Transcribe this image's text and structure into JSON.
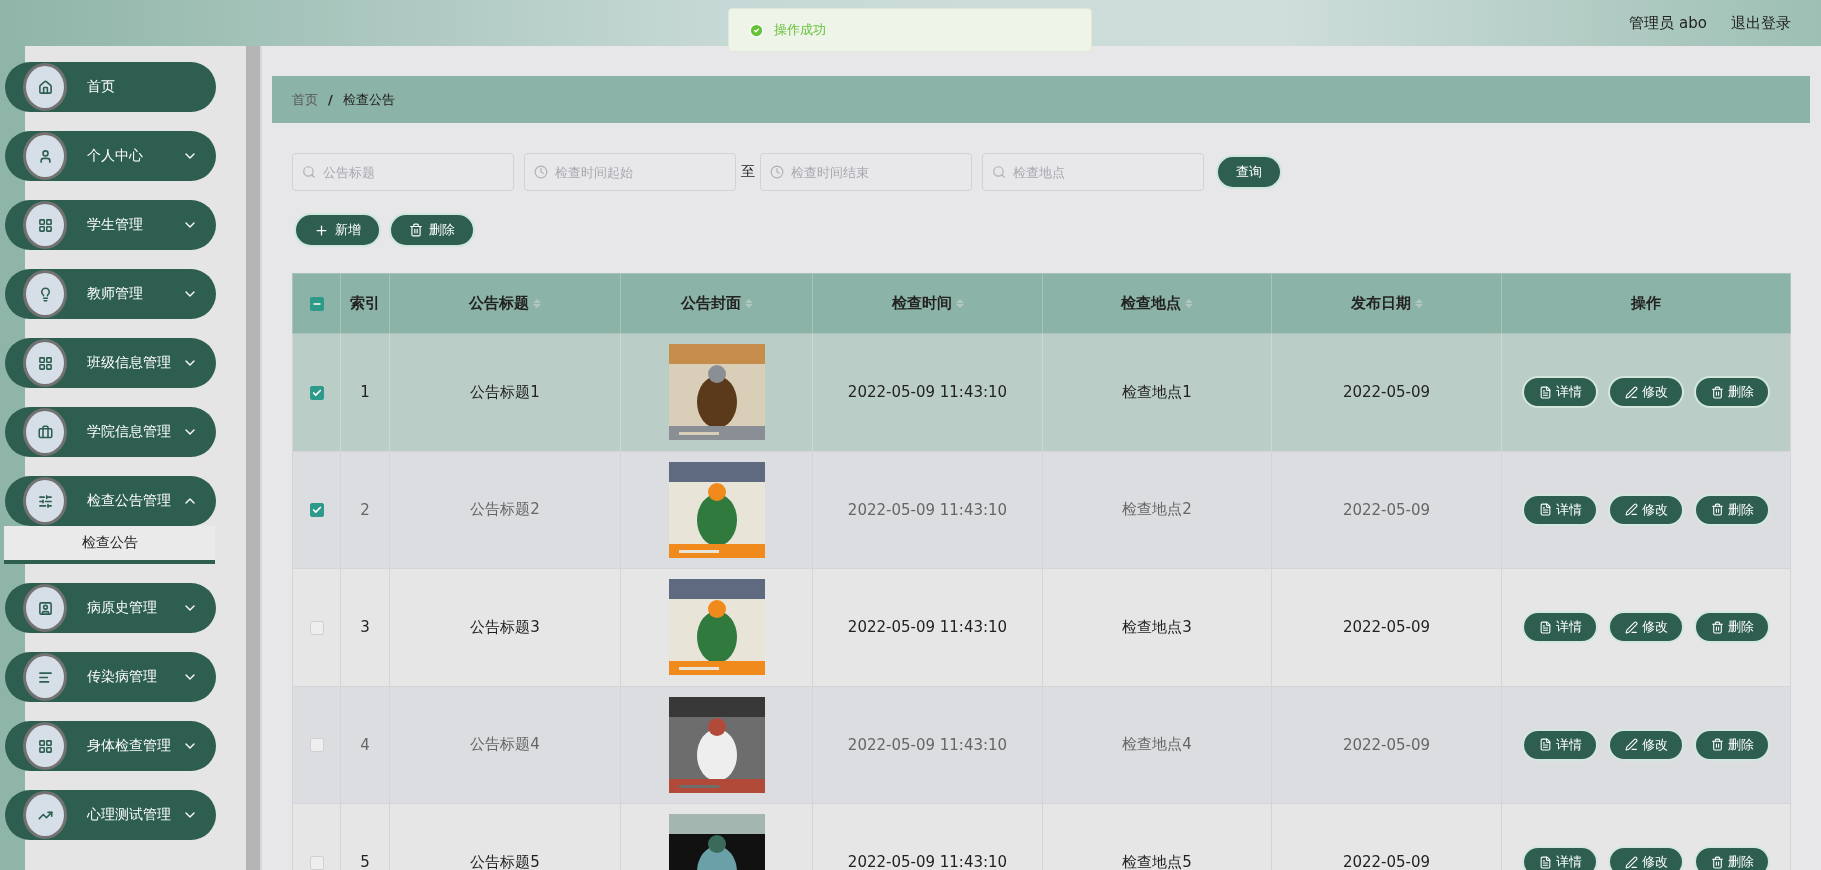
{
  "header": {
    "user": "管理员 abo",
    "logout": "退出登录"
  },
  "toast": {
    "message": "操作成功"
  },
  "sidebar": {
    "items": [
      {
        "label": "首页",
        "kind": "link"
      },
      {
        "label": "个人中心",
        "kind": "menu",
        "expanded": false
      },
      {
        "label": "学生管理",
        "kind": "menu",
        "expanded": false
      },
      {
        "label": "教师管理",
        "kind": "menu",
        "expanded": false
      },
      {
        "label": "班级信息管理",
        "kind": "menu",
        "expanded": false
      },
      {
        "label": "学院信息管理",
        "kind": "menu",
        "expanded": false
      },
      {
        "label": "检查公告管理",
        "kind": "menu",
        "expanded": true,
        "children": [
          {
            "label": "检查公告",
            "selected": true
          }
        ]
      },
      {
        "label": "病原史管理",
        "kind": "menu",
        "expanded": false
      },
      {
        "label": "传染病管理",
        "kind": "menu",
        "expanded": false
      },
      {
        "label": "身体检查管理",
        "kind": "menu",
        "expanded": false
      },
      {
        "label": "心理测试管理",
        "kind": "menu",
        "expanded": false
      }
    ]
  },
  "breadcrumb": {
    "items": [
      "首页",
      "检查公告"
    ],
    "separator": "/"
  },
  "search": {
    "title_placeholder": "公告标题",
    "start_placeholder": "检查时间起始",
    "range_separator": "至",
    "end_placeholder": "检查时间结束",
    "place_placeholder": "检查地点",
    "query_button": "查询"
  },
  "actions": {
    "add": "新增",
    "delete": "删除"
  },
  "table": {
    "select_all": {
      "indeterminate": true
    },
    "columns": [
      {
        "label": "索引",
        "sortable": false
      },
      {
        "label": "公告标题",
        "sortable": true
      },
      {
        "label": "公告封面",
        "sortable": true
      },
      {
        "label": "检查时间",
        "sortable": true
      },
      {
        "label": "检查地点",
        "sortable": true
      },
      {
        "label": "发布日期",
        "sortable": true
      },
      {
        "label": "操作",
        "sortable": false
      }
    ],
    "rows": [
      {
        "checked": true,
        "highlighted": true,
        "index": "1",
        "title": "公告标题1",
        "time": "2022-05-09 11:43:10",
        "place": "检查地点1",
        "date": "2022-05-09",
        "buttons": [
          "详情",
          "修改",
          "删除"
        ]
      },
      {
        "checked": true,
        "highlighted": false,
        "index": "2",
        "title": "公告标题2",
        "time": "2022-05-09 11:43:10",
        "place": "检查地点2",
        "date": "2022-05-09",
        "buttons": [
          "详情",
          "修改",
          "删除"
        ]
      },
      {
        "checked": false,
        "highlighted": false,
        "index": "3",
        "title": "公告标题3",
        "time": "2022-05-09 11:43:10",
        "place": "检查地点3",
        "date": "2022-05-09",
        "buttons": [
          "详情",
          "修改",
          "删除"
        ]
      },
      {
        "checked": false,
        "highlighted": false,
        "index": "4",
        "title": "公告标题4",
        "time": "2022-05-09 11:43:10",
        "place": "检查地点4",
        "date": "2022-05-09",
        "buttons": [
          "详情",
          "修改",
          "删除"
        ]
      },
      {
        "checked": false,
        "highlighted": false,
        "index": "5",
        "title": "公告标题5",
        "time": "2022-05-09 11:43:10",
        "place": "检查地点5",
        "date": "2022-05-09",
        "buttons": [
          "详情",
          "修改",
          "删除"
        ]
      }
    ]
  }
}
